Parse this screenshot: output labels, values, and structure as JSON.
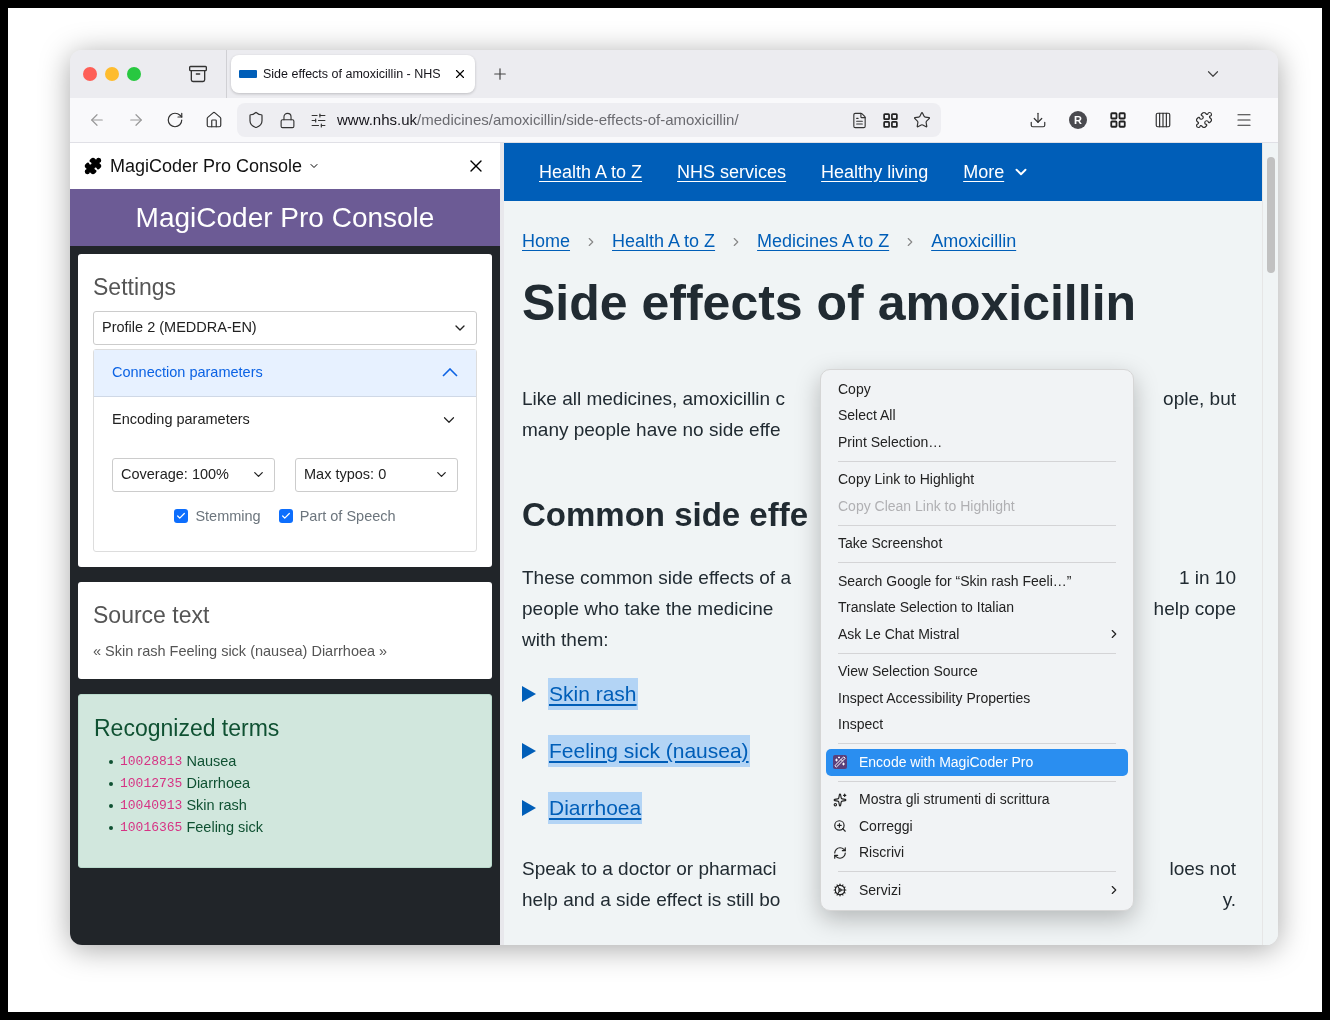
{
  "browser": {
    "tabs": [
      {
        "label": "Side effects of amoxicillin - NHS",
        "selected": true
      }
    ],
    "url": {
      "host": "www.nhs.uk",
      "path": "/medicines/amoxicillin/side-effects-of-amoxicillin/"
    },
    "profile_initial": "R"
  },
  "sidebar": {
    "title": "MagiCoder Pro Console",
    "banner": "MagiCoder Pro Console",
    "settings": {
      "title": "Settings",
      "profile": "Profile 2 (MEDDRA-EN)",
      "sections": [
        {
          "label": "Connection parameters",
          "expanded": true
        },
        {
          "label": "Encoding parameters",
          "expanded": false
        }
      ],
      "selects": [
        "Coverage: 100%",
        "Max typos: 0"
      ],
      "options": [
        {
          "label": "Stemming",
          "checked": true
        },
        {
          "label": "Part of Speech",
          "checked": true
        }
      ]
    },
    "source": {
      "title": "Source text",
      "text": "« Skin rash Feeling sick (nausea) Diarrhoea »"
    },
    "terms": {
      "title": "Recognized terms",
      "items": [
        {
          "code": "10028813",
          "term": "Nausea"
        },
        {
          "code": "10012735",
          "term": "Diarrhoea"
        },
        {
          "code": "10040913",
          "term": "Skin rash"
        },
        {
          "code": "10016365",
          "term": "Feeling sick"
        }
      ]
    }
  },
  "page": {
    "nav": [
      "Health A to Z",
      "NHS services",
      "Healthy living",
      "More"
    ],
    "breadcrumbs": [
      "Home",
      "Health A to Z",
      "Medicines A to Z",
      "Amoxicillin"
    ],
    "title": "Side effects of amoxicillin",
    "intro": [
      {
        "left": "Like all medicines, amoxicillin c",
        "right": "ople, but"
      },
      {
        "left": "many people have no side effe"
      }
    ],
    "heading": "Common side effe",
    "common": [
      {
        "left": "These common side effects of a",
        "right": "1 in 10"
      },
      {
        "left": "people who take the medicine",
        "right": "help cope"
      },
      {
        "left": "with them:"
      }
    ],
    "details": [
      {
        "label": "Skin rash",
        "selected": true
      },
      {
        "label": "Feeling sick (nausea)",
        "selected": true
      },
      {
        "label": "Diarrhoea",
        "selected": true
      }
    ],
    "advice": [
      {
        "left": "Speak to a doctor or pharmaci",
        "right": "loes not"
      },
      {
        "left": "help and a side effect is still bo",
        "right": "y."
      }
    ]
  },
  "context_menu": [
    [
      {
        "label": "Copy"
      },
      {
        "label": "Select All"
      },
      {
        "label": "Print Selection…"
      }
    ],
    [
      {
        "label": "Copy Link to Highlight"
      },
      {
        "label": "Copy Clean Link to Highlight",
        "disabled": true
      }
    ],
    [
      {
        "label": "Take Screenshot"
      }
    ],
    [
      {
        "label": "Search Google for “Skin rash Feeli…”"
      },
      {
        "label": "Translate Selection to Italian"
      },
      {
        "label": "Ask Le Chat Mistral",
        "submenu": true
      }
    ],
    [
      {
        "label": "View Selection Source"
      },
      {
        "label": "Inspect Accessibility Properties"
      },
      {
        "label": "Inspect"
      }
    ],
    [
      {
        "label": "Encode with MagiCoder Pro",
        "selected": true
      }
    ],
    [
      {
        "label": "Mostra gli strumenti di scrittura"
      },
      {
        "label": "Correggi"
      },
      {
        "label": "Riscrivi"
      }
    ],
    [
      {
        "label": "Servizi",
        "submenu": true
      }
    ]
  ]
}
